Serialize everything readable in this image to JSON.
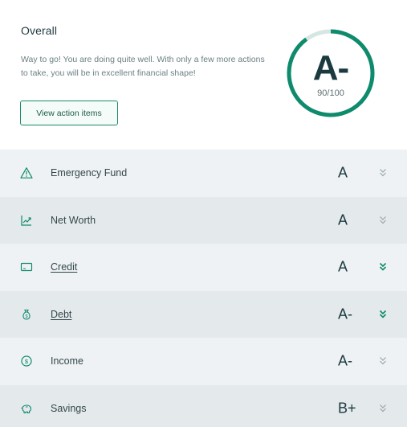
{
  "overall": {
    "title": "Overall",
    "description": "Way to go! You are doing quite well. With only a few more actions to take, you will be in excellent financial shape!",
    "button_label": "View action items",
    "grade": "A-",
    "score_text": "90/100",
    "score_fraction": 0.9
  },
  "colors": {
    "accent": "#0e8a6c",
    "ring_track": "#d6e6e2",
    "text_dark": "#1b3a40",
    "row_light": "#eef2f4",
    "row_dark": "#e4e9ec"
  },
  "categories": [
    {
      "label": "Emergency Fund",
      "grade": "A",
      "icon": "warning-triangle-icon",
      "link": false,
      "chevron": "gray"
    },
    {
      "label": "Net Worth",
      "grade": "A",
      "icon": "trending-chart-icon",
      "link": false,
      "chevron": "gray"
    },
    {
      "label": "Credit",
      "grade": "A",
      "icon": "credit-card-icon",
      "link": true,
      "chevron": "green"
    },
    {
      "label": "Debt",
      "grade": "A-",
      "icon": "money-bag-icon",
      "link": true,
      "chevron": "green"
    },
    {
      "label": "Income",
      "grade": "A-",
      "icon": "dollar-coin-icon",
      "link": false,
      "chevron": "gray"
    },
    {
      "label": "Savings",
      "grade": "B+",
      "icon": "piggy-bank-icon",
      "link": false,
      "chevron": "gray"
    }
  ]
}
